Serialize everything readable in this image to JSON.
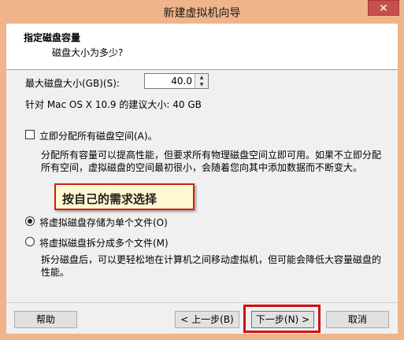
{
  "window": {
    "title": "新建虚拟机向导",
    "close_label": "✕"
  },
  "header": {
    "title": "指定磁盘容量",
    "subtitle": "磁盘大小为多少?"
  },
  "disk": {
    "max_size_label": "最大磁盘大小(GB)(S):",
    "max_size_value": "40.0",
    "recommendation": "针对 Mac OS X 10.9 的建议大小: 40 GB"
  },
  "allocate": {
    "checkbox_label": "立即分配所有磁盘空间(A)。",
    "checked": false,
    "description": "分配所有容量可以提高性能，但要求所有物理磁盘空间立即可用。如果不立即分配所有空间，虚拟磁盘的空间最初很小，会随着您向其中添加数据而不断变大。"
  },
  "annotation": {
    "text": "按自己的需求选择"
  },
  "storage": {
    "single_file_label": "将虚拟磁盘存储为单个文件(O)",
    "multi_file_label": "将虚拟磁盘拆分成多个文件(M)",
    "selected": "single",
    "description": "拆分磁盘后，可以更轻松地在计算机之间移动虚拟机，但可能会降低大容量磁盘的性能。"
  },
  "buttons": {
    "help": "帮助",
    "back": "< 上一步(B)",
    "next": "下一步(N) >",
    "cancel": "取消"
  },
  "colors": {
    "title_bar": "#f0b48a",
    "close": "#c7504a",
    "highlight": "#d01010",
    "annotation_bg": "#fff8d0"
  },
  "icons": {
    "spin_up": "▲",
    "spin_down": "▼"
  }
}
